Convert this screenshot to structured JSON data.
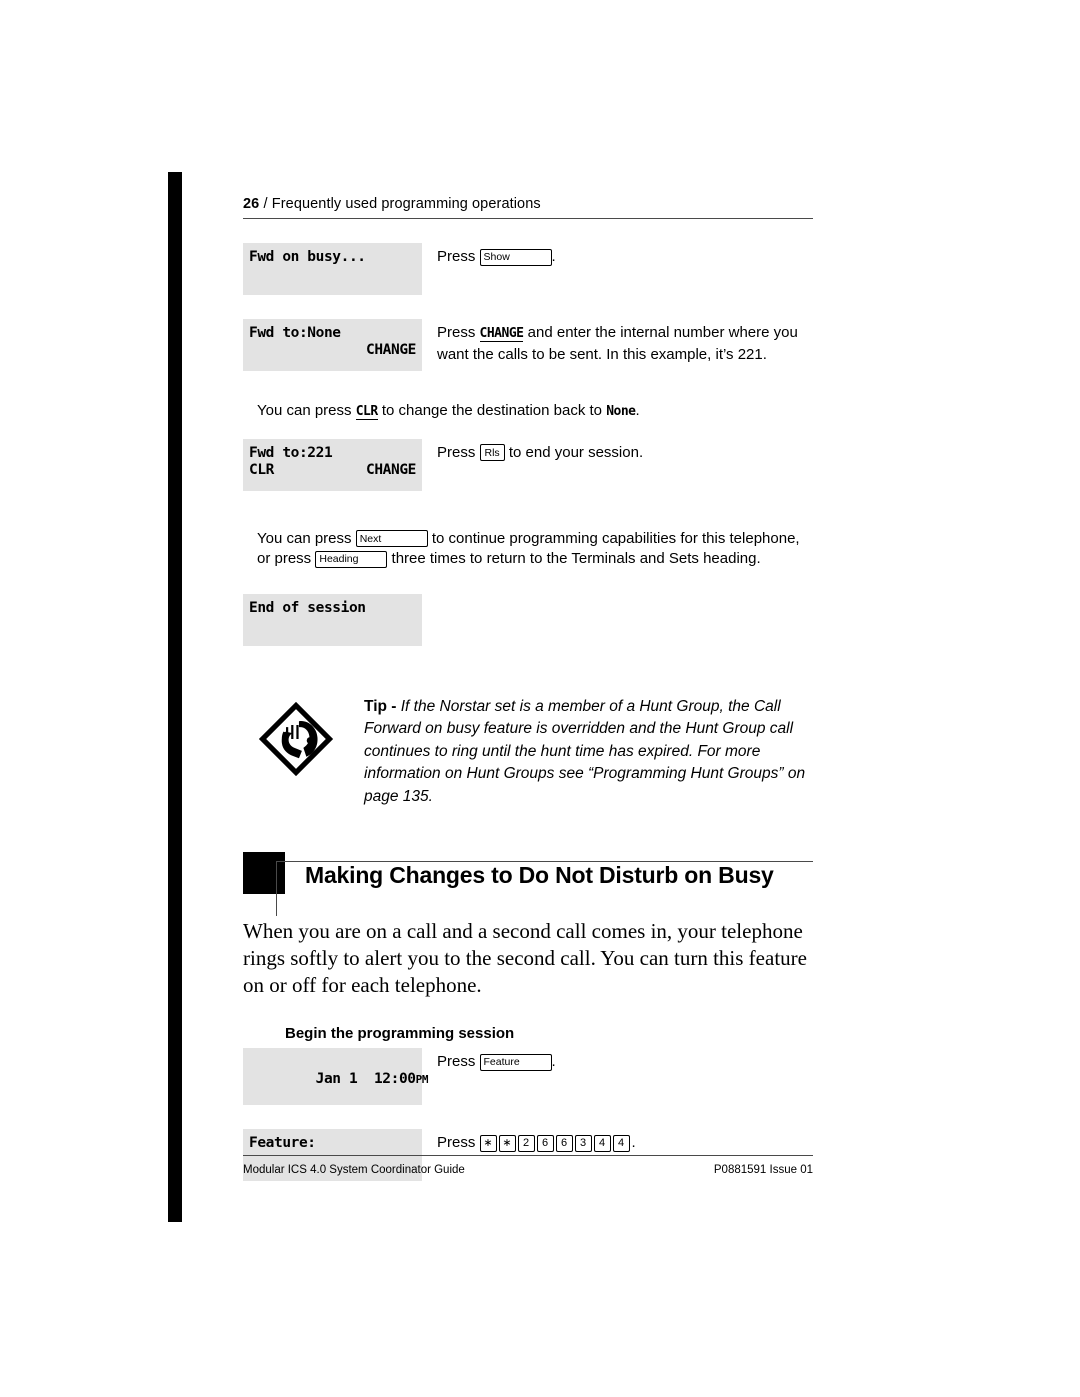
{
  "running_header": {
    "page_number": "26",
    "separator": "/",
    "title": "Frequently used programming operations"
  },
  "steps": [
    {
      "display_left": "Fwd on busy...",
      "display_right": "",
      "display_line2_left": "",
      "display_line2_right": "",
      "instruction_prefix": "Press",
      "key_label": "Show",
      "instruction_suffix": "."
    },
    {
      "display_left": "Fwd to:None",
      "display_right": "",
      "display_line2_left": "",
      "display_line2_right": "CHANGE",
      "instruction_line1_prefix": "Press",
      "instruction_softkey": "CHANGE",
      "instruction_line1_suffix": "and enter the internal number where",
      "instruction_line2": "you want the calls to be sent. In this example, it’s 221."
    },
    {
      "display_left": "Fwd to:221",
      "display_line2_left": "CLR",
      "display_line2_right": "CHANGE",
      "instruction_prefix": "Press",
      "key_label": "Rls",
      "instruction_suffix": "to end your session."
    },
    {
      "display_left": "End of session",
      "display_line2_left": "",
      "display_line2_right": ""
    }
  ],
  "note_clr": {
    "prefix": "You can press",
    "softkey": "CLR",
    "middle": "to change the destination back to",
    "mono_value": "None",
    "suffix": "."
  },
  "note_next": {
    "line1_prefix": "You can press",
    "key_next": "Next",
    "line1_suffix": "to continue programming capabilities for this",
    "line2_prefix": "telephone, or press",
    "key_heading": "Heading",
    "line2_suffix": "three times to return to the Terminals and Sets",
    "line3": "heading."
  },
  "tip": {
    "icon_name": "listening-tip-icon",
    "label": "Tip -",
    "text": "If the Norstar set is a member of a Hunt Group, the Call Forward on busy feature is overridden and the Hunt Group call continues to ring until the hunt time has expired. For more information on Hunt Groups see “Programming Hunt Groups” on page 135."
  },
  "section": {
    "title": "Making Changes to Do Not Disturb on Busy",
    "body": "When you are on a call and a second call comes in, your telephone rings softly to alert you to the second call. You can turn this feature on or off for each telephone.",
    "subheading": "Begin the programming session"
  },
  "session_steps": [
    {
      "display_left": "Jan 1",
      "display_time": "12:00",
      "display_ampm": "PM",
      "instruction_prefix": "Press",
      "key_label": "Feature",
      "instruction_suffix": "."
    },
    {
      "display_left": "Feature:",
      "instruction_prefix": "Press",
      "keys": [
        "∗",
        "∗",
        "2",
        "6",
        "6",
        "3",
        "4",
        "4"
      ],
      "instruction_suffix": "."
    }
  ],
  "footer": {
    "left": "Modular ICS 4.0 System Coordinator Guide",
    "right": "P0881591 Issue 01"
  },
  "colors": {
    "lcd_background": "#e3e3e3",
    "rule": "#4a4a4a",
    "ink": "#000000"
  }
}
